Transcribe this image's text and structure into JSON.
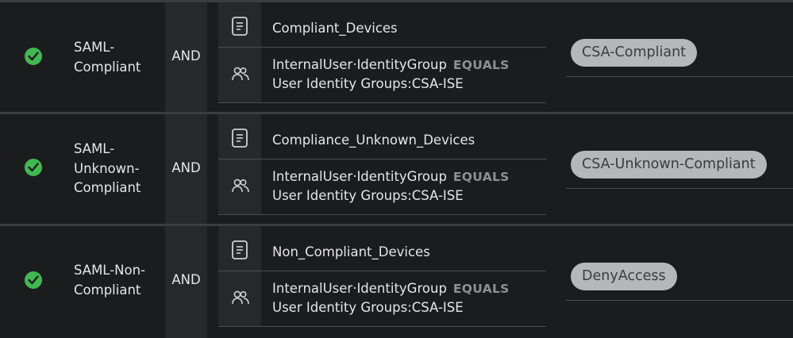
{
  "rules": [
    {
      "name": "SAML-\nCompliant",
      "name_lines": [
        "SAML-",
        "Compliant"
      ],
      "operator": "AND",
      "condition_1": "Compliant_Devices",
      "condition_2_attr": "InternalUser·IdentityGroup",
      "condition_2_op": "EQUALS",
      "condition_2_value": "User Identity Groups:CSA-ISE",
      "result": "CSA-Compliant"
    },
    {
      "name_lines": [
        "SAML-",
        "Unknown-",
        "Compliant"
      ],
      "operator": "AND",
      "condition_1": "Compliance_Unknown_Devices",
      "condition_2_attr": "InternalUser·IdentityGroup",
      "condition_2_op": "EQUALS",
      "condition_2_value": "User Identity Groups:CSA-ISE",
      "result": "CSA-Unknown-Compliant"
    },
    {
      "name_lines": [
        "SAML-Non-",
        "Compliant"
      ],
      "operator": "AND",
      "condition_1": "Non_Compliant_Devices",
      "condition_2_attr": "InternalUser·IdentityGroup",
      "condition_2_op": "EQUALS",
      "condition_2_value": "User Identity Groups:CSA-ISE",
      "result": "DenyAccess"
    }
  ],
  "icons": {
    "status": "check-circle-icon",
    "condition_1": "document-icon",
    "condition_2": "user-group-icon"
  },
  "colors": {
    "status_enabled": "#3fb950",
    "result_pill": "#b5b7ba",
    "background": "#1b1c1e"
  }
}
